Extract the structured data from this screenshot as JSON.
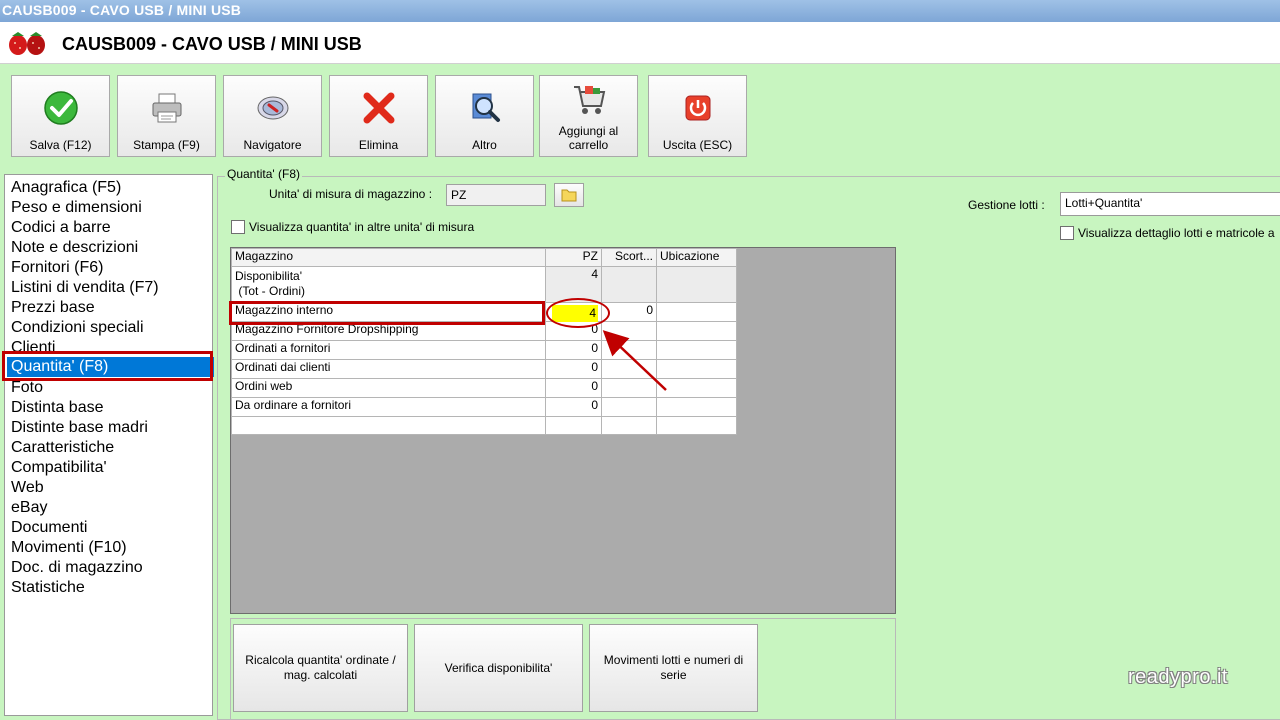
{
  "window": {
    "title": "CAUSB009 - CAVO USB / MINI USB"
  },
  "header": {
    "title": "CAUSB009 - CAVO USB / MINI USB"
  },
  "toolbar": {
    "buttons": [
      {
        "label": "Salva (F12)",
        "icon": "check-icon"
      },
      {
        "label": "Stampa (F9)",
        "icon": "printer-icon"
      },
      {
        "label": "Navigatore",
        "icon": "compass-icon"
      },
      {
        "label": "Elimina",
        "icon": "delete-x-icon"
      },
      {
        "label": "Altro",
        "icon": "magnifier-icon"
      },
      {
        "label": "Aggiungi al carrello",
        "icon": "cart-icon"
      },
      {
        "label": "Uscita (ESC)",
        "icon": "power-icon"
      }
    ]
  },
  "sidebar": {
    "items": [
      "Anagrafica (F5)",
      "Peso e dimensioni",
      "Codici a barre",
      "Note e descrizioni",
      "Fornitori (F6)",
      "Listini di vendita (F7)",
      "Prezzi base",
      "Condizioni speciali",
      "Clienti",
      "Quantita' (F8)",
      "Foto",
      "Distinta base",
      "Distinte base madri",
      "Caratteristiche",
      "Compatibilita'",
      "Web",
      "eBay",
      "Documenti",
      "Movimenti (F10)",
      "Doc. di magazzino",
      "Statistiche"
    ],
    "selected": "Quantita' (F8)"
  },
  "panel": {
    "group_title": "Quantita' (F8)",
    "um_label": "Unita' di misura di magazzino :",
    "um_value": "PZ",
    "show_other_units_label": "Visualizza quantita' in altre unita' di misura",
    "lot_label": "Gestione lotti :",
    "lot_value": "Lotti+Quantita'",
    "show_lot_detail_label": "Visualizza dettaglio lotti e matricole a"
  },
  "grid": {
    "headers": [
      "Magazzino",
      "PZ",
      "Scort...",
      "Ubicazione"
    ],
    "rows": [
      {
        "name": "Disponibilita'\n (Tot - Ordini)",
        "qty": "4",
        "scorta": "",
        "ubicazione": ""
      },
      {
        "name": "Magazzino interno",
        "qty": "4",
        "scorta": "0",
        "ubicazione": ""
      },
      {
        "name": "Magazzino Fornitore Dropshipping",
        "qty": "0",
        "scorta": "",
        "ubicazione": ""
      },
      {
        "name": "Ordinati a fornitori",
        "qty": "0",
        "scorta": "",
        "ubicazione": ""
      },
      {
        "name": "Ordinati dai clienti",
        "qty": "0",
        "scorta": "",
        "ubicazione": ""
      },
      {
        "name": "Ordini web",
        "qty": "0",
        "scorta": "",
        "ubicazione": ""
      },
      {
        "name": "Da ordinare a fornitori",
        "qty": "0",
        "scorta": "",
        "ubicazione": ""
      }
    ]
  },
  "bottom_buttons": [
    "Ricalcola quantita' ordinate / mag. calcolati",
    "Verifica disponibilita'",
    "Movimenti lotti e numeri di serie"
  ],
  "watermark": "readypro.it",
  "colors": {
    "background": "#c8f5c0",
    "selection": "#0078d7",
    "highlight_red": "#c00000",
    "cell_yellow": "#ffff00"
  }
}
